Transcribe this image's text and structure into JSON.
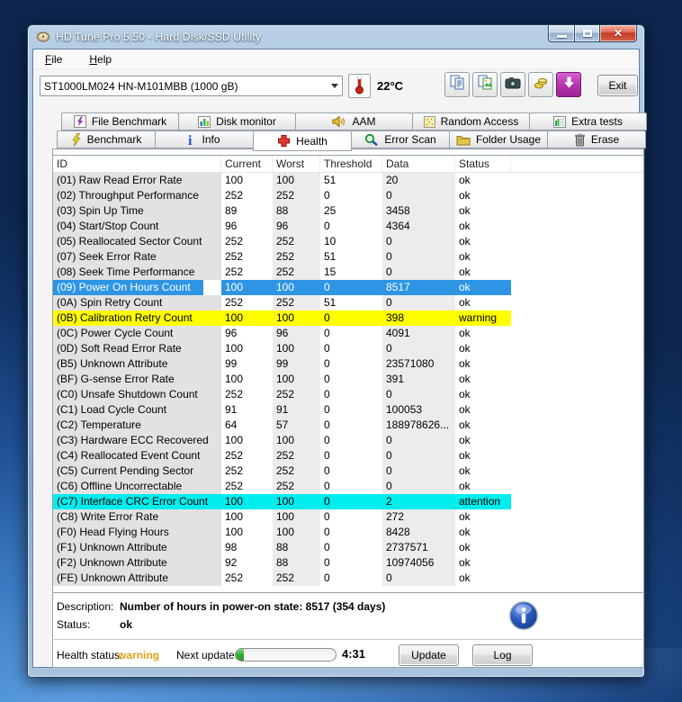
{
  "window": {
    "title": "HD Tune Pro 5.50 - Hard Disk/SSD Utility",
    "controls": [
      {
        "name": "minimize-button"
      },
      {
        "name": "maximize-button"
      },
      {
        "name": "close-button"
      }
    ]
  },
  "menu": {
    "items": [
      {
        "label": "File"
      },
      {
        "label": "Help"
      }
    ]
  },
  "toolbar": {
    "drive_select": "ST1000LM024 HN-M101MBB (1000 gB)",
    "temperature": "22°C",
    "exit_label": "Exit",
    "buttons": [
      {
        "name": "copy-text-button",
        "icon": "copy-text-icon"
      },
      {
        "name": "copy-image-button",
        "icon": "copy-image-icon"
      },
      {
        "name": "screenshot-button",
        "icon": "camera-icon"
      },
      {
        "name": "save-button",
        "icon": "save-icon"
      },
      {
        "name": "download-button",
        "icon": "download-icon",
        "accent": true
      }
    ]
  },
  "tabs": {
    "row1": [
      {
        "label": "File Benchmark",
        "icon": "purple-bolt-icon"
      },
      {
        "label": "Disk monitor",
        "icon": "bar-chart-icon"
      },
      {
        "label": "AAM",
        "icon": "speaker-icon"
      },
      {
        "label": "Random Access",
        "icon": "dotted-square-icon"
      },
      {
        "label": "Extra tests",
        "icon": "chart-grid-icon"
      }
    ],
    "row2": [
      {
        "label": "Benchmark",
        "icon": "yellow-bolt-icon"
      },
      {
        "label": "Info",
        "icon": "info-icon"
      },
      {
        "label": "Health",
        "icon": "red-cross-icon",
        "active": true
      },
      {
        "label": "Error Scan",
        "icon": "magnifier-icon"
      },
      {
        "label": "Folder Usage",
        "icon": "folder-icon"
      },
      {
        "label": "Erase",
        "icon": "trash-icon"
      }
    ]
  },
  "table": {
    "columns": [
      "ID",
      "Current",
      "Worst",
      "Threshold",
      "Data",
      "Status"
    ],
    "rows": [
      {
        "id": "(01) Raw Read Error Rate",
        "current": "100",
        "worst": "100",
        "threshold": "51",
        "data": "20",
        "status": "ok",
        "highlight": "none"
      },
      {
        "id": "(02) Throughput Performance",
        "current": "252",
        "worst": "252",
        "threshold": "0",
        "data": "0",
        "status": "ok",
        "highlight": "none"
      },
      {
        "id": "(03) Spin Up Time",
        "current": "89",
        "worst": "88",
        "threshold": "25",
        "data": "3458",
        "status": "ok",
        "highlight": "none"
      },
      {
        "id": "(04) Start/Stop Count",
        "current": "96",
        "worst": "96",
        "threshold": "0",
        "data": "4364",
        "status": "ok",
        "highlight": "none"
      },
      {
        "id": "(05) Reallocated Sector Count",
        "current": "252",
        "worst": "252",
        "threshold": "10",
        "data": "0",
        "status": "ok",
        "highlight": "none"
      },
      {
        "id": "(07) Seek Error Rate",
        "current": "252",
        "worst": "252",
        "threshold": "51",
        "data": "0",
        "status": "ok",
        "highlight": "none"
      },
      {
        "id": "(08) Seek Time Performance",
        "current": "252",
        "worst": "252",
        "threshold": "15",
        "data": "0",
        "status": "ok",
        "highlight": "none"
      },
      {
        "id": "(09) Power On Hours Count",
        "current": "100",
        "worst": "100",
        "threshold": "0",
        "data": "8517",
        "status": "ok",
        "highlight": "selected"
      },
      {
        "id": "(0A) Spin Retry Count",
        "current": "252",
        "worst": "252",
        "threshold": "51",
        "data": "0",
        "status": "ok",
        "highlight": "none"
      },
      {
        "id": "(0B) Calibration Retry Count",
        "current": "100",
        "worst": "100",
        "threshold": "0",
        "data": "398",
        "status": "warning",
        "highlight": "warning"
      },
      {
        "id": "(0C) Power Cycle Count",
        "current": "96",
        "worst": "96",
        "threshold": "0",
        "data": "4091",
        "status": "ok",
        "highlight": "none"
      },
      {
        "id": "(0D) Soft Read Error Rate",
        "current": "100",
        "worst": "100",
        "threshold": "0",
        "data": "0",
        "status": "ok",
        "highlight": "none"
      },
      {
        "id": "(B5) Unknown Attribute",
        "current": "99",
        "worst": "99",
        "threshold": "0",
        "data": "23571080",
        "status": "ok",
        "highlight": "none"
      },
      {
        "id": "(BF) G-sense Error Rate",
        "current": "100",
        "worst": "100",
        "threshold": "0",
        "data": "391",
        "status": "ok",
        "highlight": "none"
      },
      {
        "id": "(C0) Unsafe Shutdown Count",
        "current": "252",
        "worst": "252",
        "threshold": "0",
        "data": "0",
        "status": "ok",
        "highlight": "none"
      },
      {
        "id": "(C1) Load Cycle Count",
        "current": "91",
        "worst": "91",
        "threshold": "0",
        "data": "100053",
        "status": "ok",
        "highlight": "none"
      },
      {
        "id": "(C2) Temperature",
        "current": "64",
        "worst": "57",
        "threshold": "0",
        "data": "188978626...",
        "status": "ok",
        "highlight": "none"
      },
      {
        "id": "(C3) Hardware ECC Recovered",
        "current": "100",
        "worst": "100",
        "threshold": "0",
        "data": "0",
        "status": "ok",
        "highlight": "none"
      },
      {
        "id": "(C4) Reallocated Event Count",
        "current": "252",
        "worst": "252",
        "threshold": "0",
        "data": "0",
        "status": "ok",
        "highlight": "none"
      },
      {
        "id": "(C5) Current Pending Sector",
        "current": "252",
        "worst": "252",
        "threshold": "0",
        "data": "0",
        "status": "ok",
        "highlight": "none"
      },
      {
        "id": "(C6) Offline Uncorrectable",
        "current": "252",
        "worst": "252",
        "threshold": "0",
        "data": "0",
        "status": "ok",
        "highlight": "none"
      },
      {
        "id": "(C7) Interface CRC Error Count",
        "current": "100",
        "worst": "100",
        "threshold": "0",
        "data": "2",
        "status": "attention",
        "highlight": "attention"
      },
      {
        "id": "(C8) Write Error Rate",
        "current": "100",
        "worst": "100",
        "threshold": "0",
        "data": "272",
        "status": "ok",
        "highlight": "none"
      },
      {
        "id": "(F0) Head Flying Hours",
        "current": "100",
        "worst": "100",
        "threshold": "0",
        "data": "8428",
        "status": "ok",
        "highlight": "none"
      },
      {
        "id": "(F1) Unknown Attribute",
        "current": "98",
        "worst": "88",
        "threshold": "0",
        "data": "2737571",
        "status": "ok",
        "highlight": "none"
      },
      {
        "id": "(F2) Unknown Attribute",
        "current": "92",
        "worst": "88",
        "threshold": "0",
        "data": "10974056",
        "status": "ok",
        "highlight": "none"
      },
      {
        "id": "(FE) Unknown Attribute",
        "current": "252",
        "worst": "252",
        "threshold": "0",
        "data": "0",
        "status": "ok",
        "highlight": "none"
      }
    ]
  },
  "details": {
    "description_label": "Description:",
    "description_value": "Number of hours in power-on state: 8517 (354 days)",
    "status_label": "Status:",
    "status_value": "ok"
  },
  "footer": {
    "health_label": "Health status:",
    "health_value": "warning",
    "next_update_label": "Next update:",
    "progress_percent": 8,
    "countdown": "4:31",
    "update_label": "Update",
    "log_label": "Log"
  },
  "colors": {
    "selection_blue": "#2e95e5",
    "warning_yellow": "#ffff00",
    "attention_cyan": "#00eded",
    "health_warning_text": "#e3a11b",
    "progress_green": "#35ad35",
    "accent_button_purple": "#b637ad"
  }
}
